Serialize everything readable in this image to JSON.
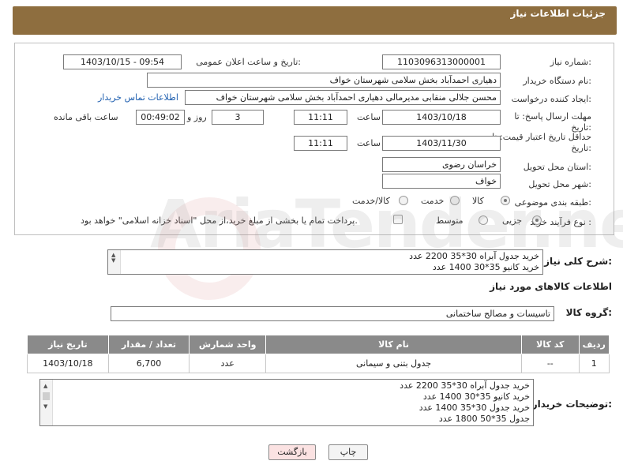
{
  "header": {
    "title": "جزئیات اطلاعات نیاز"
  },
  "form": {
    "need_number": {
      "label": "شماره نیاز:",
      "value": "1103096313000001"
    },
    "announce_datetime": {
      "label": "تاریخ و ساعت اعلان عمومی:",
      "value": "1403/10/15 - 09:54"
    },
    "buyer_org": {
      "label": "نام دستگاه خریدار:",
      "value": "دهیاری احمدآباد بخش سلامی شهرستان خواف"
    },
    "requester": {
      "label": "ایجاد کننده درخواست:",
      "value": "محسن جلالی منقابی مدیرمالی دهیاری احمدآباد بخش سلامی شهرستان خواف",
      "contact_link": "اطلاعات تماس خریدار"
    },
    "reply_deadline": {
      "label_line1": "مهلت ارسال پاسخ: تا",
      "label_line2": "تاریخ:",
      "date": "1403/10/18",
      "time_label": "ساعت",
      "time": "11:11",
      "days": "3",
      "days_label": "روز و",
      "remaining": "00:49:02",
      "remaining_label": "ساعت باقی مانده"
    },
    "price_validity": {
      "label_line1": "حداقل تاریخ اعتبار قیمت: تا",
      "label_line2": "تاریخ:",
      "date": "1403/11/30",
      "time_label": "ساعت",
      "time": "11:11"
    },
    "delivery_province": {
      "label": "استان محل تحویل:",
      "value": "خراسان رضوی"
    },
    "delivery_city": {
      "label": "شهر محل تحویل:",
      "value": "خواف"
    },
    "category": {
      "label": "طبقه بندی موضوعی:",
      "options": [
        "کالا",
        "خدمت",
        "کالا/خدمت"
      ],
      "selected": "کالا"
    },
    "purchase_process": {
      "label": "نوع فرآیند خرید :",
      "options": [
        "جزیی",
        "متوسط"
      ],
      "payment_note": "پرداخت تمام یا بخشی از مبلغ خرید،از محل \"اسناد خزانه اسلامی\" خواهد بود."
    }
  },
  "summary": {
    "label": "شرح کلی نیاز:",
    "lines": [
      "خرید جدول آبراه 30*35   2200 عدد",
      "خرید کانیو 35*30 1400 عدد"
    ]
  },
  "goods_section": {
    "title": "اطلاعات کالاهای مورد نیاز",
    "group_label": "گروه کالا:",
    "group_value": "تاسیسات و مصالح ساختمانی"
  },
  "table": {
    "headers": [
      "ردیف",
      "کد کالا",
      "نام کالا",
      "واحد شمارش",
      "تعداد / مقدار",
      "تاریخ نیاز"
    ],
    "rows": [
      [
        "1",
        "--",
        "جدول بتنی و سیمانی",
        "عدد",
        "6,700",
        "1403/10/18"
      ]
    ]
  },
  "buyer_notes": {
    "label": "توضیحات خریدار:",
    "lines": [
      "خرید جدول آبراه 30*35   2200 عدد",
      "خرید کانیو 35*30 1400 عدد",
      "خرید جدول 30*35 1400 عدد",
      "جدول 35*50  1800 عدد"
    ]
  },
  "buttons": {
    "print": "چاپ",
    "back": "بازگشت"
  },
  "watermark": "AriaTender.neT",
  "colors": {
    "header_bg": "#8e6e3f",
    "table_header_bg": "#8a8a8a",
    "link": "#2060b0",
    "back_button_bg": "#fbe2e2"
  }
}
